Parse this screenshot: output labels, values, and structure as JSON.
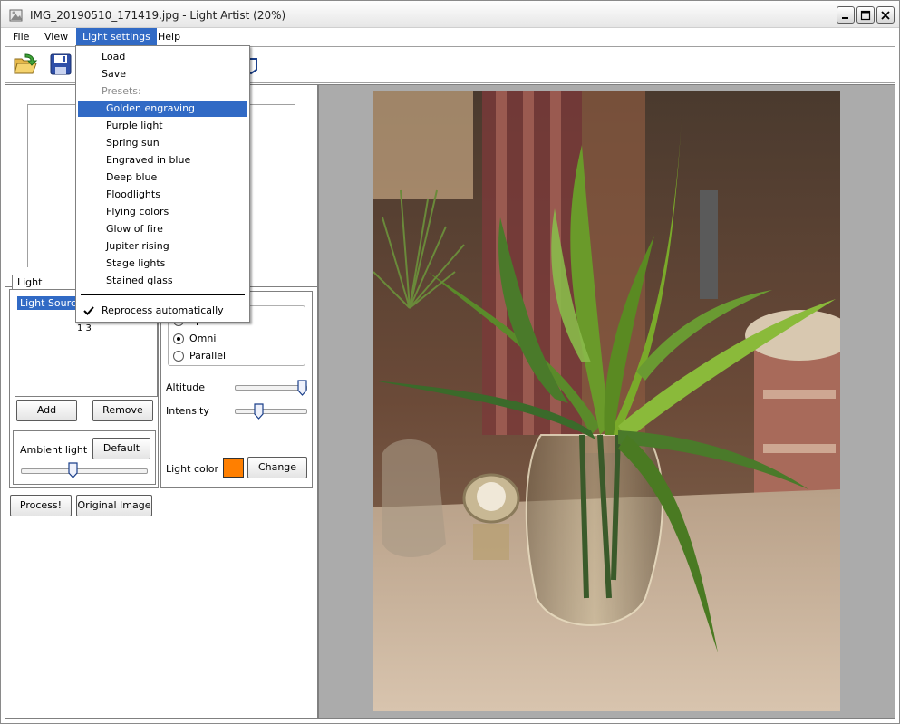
{
  "window": {
    "title": "IMG_20190510_171419.jpg - Light Artist (20%)"
  },
  "menubar": {
    "file": "File",
    "view": "View",
    "light_settings": "Light settings",
    "help": "Help"
  },
  "dropdown": {
    "load": "Load",
    "save": "Save",
    "presets_header": "Presets:",
    "presets": [
      "Golden engraving",
      "Purple light",
      "Spring sun",
      "Engraved in blue",
      "Deep blue",
      "Floodlights",
      "Flying colors",
      "Glow of fire",
      "Jupiter rising",
      "Stage lights",
      "Stained glass"
    ],
    "highlighted": "Golden engraving",
    "reprocess": "Reprocess automatically",
    "reprocess_checked": true
  },
  "light_sources": {
    "tab_label": "Light sources",
    "selected_item": "Light Source",
    "partial_text": "1 3",
    "add_label": "Add",
    "remove_label": "Remove"
  },
  "ambient": {
    "label": "Ambient light",
    "default_label": "Default",
    "level": 0.4
  },
  "light_props": {
    "type_spot": "Spot",
    "type_omni": "Omni",
    "type_parallel": "Parallel",
    "selected_type": "Omni",
    "altitude_label": "Altitude",
    "altitude_level": 1.0,
    "intensity_label": "Intensity",
    "intensity_level": 0.3,
    "color_label": "Light color",
    "color_value": "#ff7f00",
    "change_label": "Change"
  },
  "actions": {
    "process_label": "Process!",
    "original_label": "Original Image"
  },
  "colors": {
    "selection": "#316ac5",
    "light_color": "#ff7f00"
  }
}
